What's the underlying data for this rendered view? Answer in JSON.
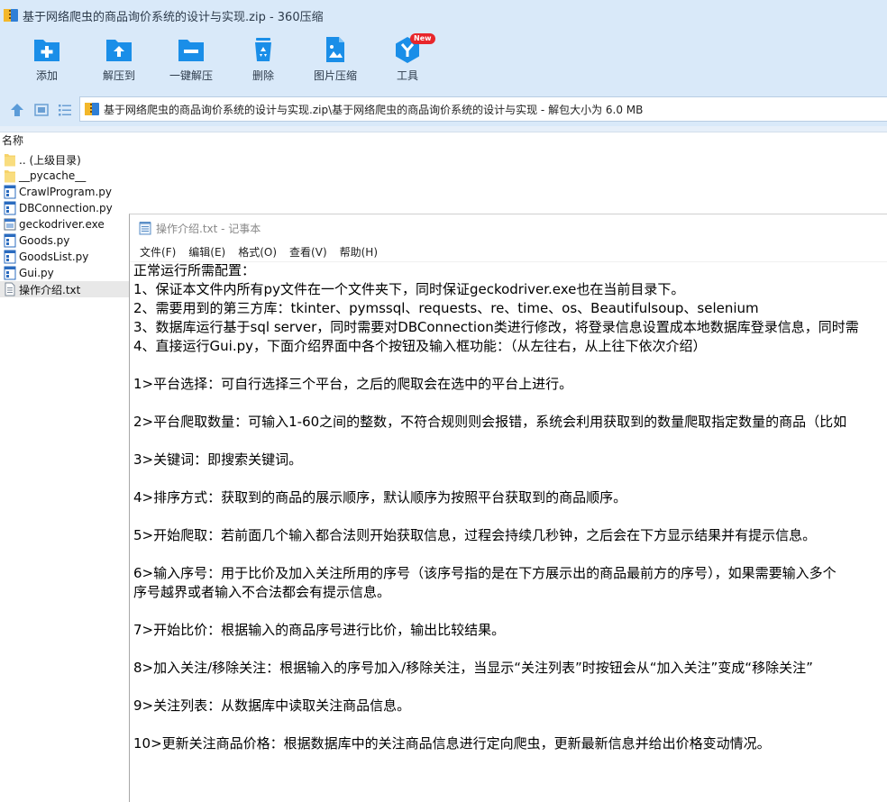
{
  "window": {
    "title": "基于网络爬虫的商品询价系统的设计与实现.zip - 360压缩"
  },
  "toolbar": {
    "items": [
      {
        "label": "添加",
        "icon": "add-file-icon"
      },
      {
        "label": "解压到",
        "icon": "extract-to-icon"
      },
      {
        "label": "一键解压",
        "icon": "one-click-extract-icon"
      },
      {
        "label": "删除",
        "icon": "recycle-bin-icon"
      },
      {
        "label": "图片压缩",
        "icon": "image-compress-icon"
      },
      {
        "label": "工具",
        "icon": "tools-icon",
        "badge": "New"
      }
    ],
    "accent": "#1a8ee8"
  },
  "address": {
    "path": "基于网络爬虫的商品询价系统的设计与实现.zip\\基于网络爬虫的商品询价系统的设计与实现 - 解包大小为 6.0 MB"
  },
  "columns": {
    "name": "名称"
  },
  "files": [
    {
      "name": ".. (上级目录)",
      "type": "folder"
    },
    {
      "name": "__pycache__",
      "type": "folder"
    },
    {
      "name": "CrawlProgram.py",
      "type": "py"
    },
    {
      "name": "DBConnection.py",
      "type": "py"
    },
    {
      "name": "geckodriver.exe",
      "type": "exe"
    },
    {
      "name": "Goods.py",
      "type": "py"
    },
    {
      "name": "GoodsList.py",
      "type": "py"
    },
    {
      "name": "Gui.py",
      "type": "py"
    },
    {
      "name": "操作介绍.txt",
      "type": "txt",
      "selected": true
    }
  ],
  "notepad": {
    "title": "操作介绍.txt - 记事本",
    "menu": [
      "文件(F)",
      "编辑(E)",
      "格式(O)",
      "查看(V)",
      "帮助(H)"
    ],
    "lines": [
      "正常运行所需配置：",
      "1、保证本文件内所有py文件在一个文件夹下，同时保证geckodriver.exe也在当前目录下。",
      "2、需要用到的第三方库：tkinter、pymssql、requests、re、time、os、Beautifulsoup、selenium",
      "3、数据库运行基于sql server，同时需要对DBConnection类进行修改，将登录信息设置成本地数据库登录信息，同时需",
      "4、直接运行Gui.py，下面介绍界面中各个按钮及输入框功能：（从左往右，从上往下依次介绍）",
      "",
      "1>平台选择：可自行选择三个平台，之后的爬取会在选中的平台上进行。",
      "",
      "2>平台爬取数量：可输入1-60之间的整数，不符合规则则会报错，系统会利用获取到的数量爬取指定数量的商品（比如",
      "",
      "3>关键词：即搜索关键词。",
      "",
      "4>排序方式：获取到的商品的展示顺序，默认顺序为按照平台获取到的商品顺序。",
      "",
      "5>开始爬取：若前面几个输入都合法则开始获取信息，过程会持续几秒钟，之后会在下方显示结果并有提示信息。",
      "",
      "6>输入序号：用于比价及加入关注所用的序号（该序号指的是在下方展示出的商品最前方的序号），如果需要输入多个",
      "序号越界或者输入不合法都会有提示信息。",
      "",
      "7>开始比价：根据输入的商品序号进行比价，输出比较结果。",
      "",
      "8>加入关注/移除关注：根据输入的序号加入/移除关注，当显示“关注列表”时按钮会从“加入关注”变成“移除关注”",
      "",
      "9>关注列表：从数据库中读取关注商品信息。",
      "",
      "10>更新关注商品价格：根据数据库中的关注商品信息进行定向爬虫，更新最新信息并给出价格变动情况。"
    ]
  }
}
